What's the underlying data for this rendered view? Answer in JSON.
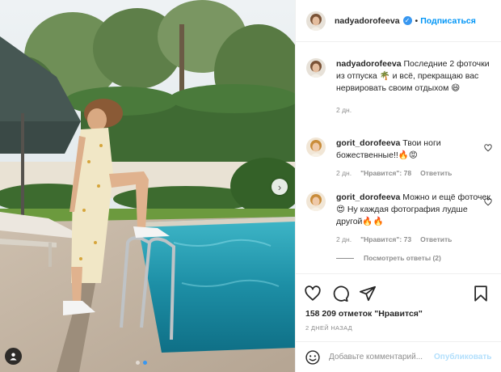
{
  "photo": {
    "alt_icon": "user-tag-icon",
    "carousel": {
      "count": 2,
      "active_index": 1
    }
  },
  "header": {
    "username": "nadyadorofeeva",
    "separator": "•",
    "follow_label": "Подписаться"
  },
  "caption": {
    "username": "nadyadorofeeva",
    "text": " Последние 2 фоточки из отпуска 🌴 и всё, прекращаю вас нервировать своим отдыхом 😄",
    "time": "2 дн."
  },
  "comments": [
    {
      "username": "gorit_dorofeeva",
      "text": " Твои ноги божественные!!🔥😡",
      "time": "2 дн.",
      "likes": "\"Нравится\": 78",
      "reply": "Ответить"
    },
    {
      "username": "gorit_dorofeeva",
      "text": " Можно и ещё фоточек😍 Ну каждая фотография лудше другой🔥🔥",
      "time": "2 дн.",
      "likes": "\"Нравится\": 73",
      "reply": "Ответить"
    }
  ],
  "view_replies": "Посмотреть ответы (2)",
  "actions": {
    "likes_text": "158 209 отметок \"Нравится\"",
    "date": "2 ДНЕЙ НАЗАД"
  },
  "add_comment": {
    "placeholder": "Добавьте комментарий...",
    "post_label": "Опубликовать"
  },
  "colors": {
    "accent": "#0095f6",
    "verified": "#3897f0",
    "muted": "#8e8e8e",
    "post_disabled": "#b2dffc"
  }
}
